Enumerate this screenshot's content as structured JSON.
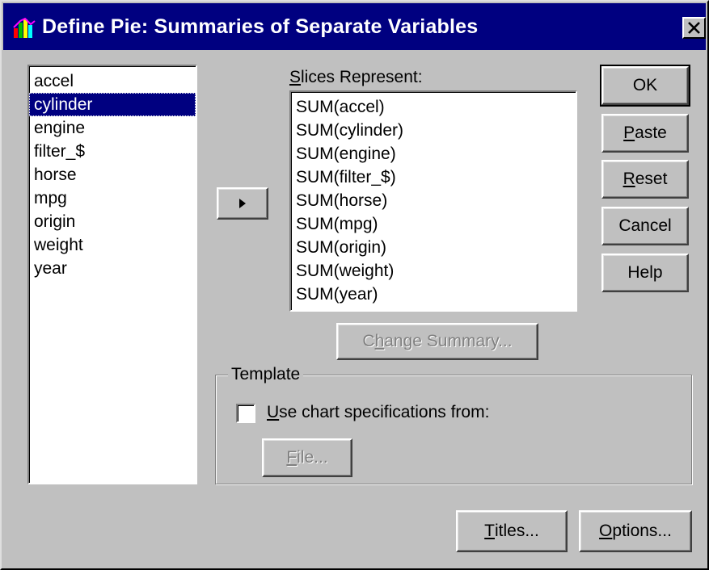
{
  "window": {
    "title": "Define Pie: Summaries of Separate Variables",
    "close_glyph": "✕"
  },
  "variables": [
    "accel",
    "cylinder",
    "engine",
    "filter_$",
    "horse",
    "mpg",
    "origin",
    "weight",
    "year"
  ],
  "selected_variable": "cylinder",
  "slices": {
    "label_accel": "S",
    "label_rest": "lices Represent:",
    "items": [
      "SUM(accel)",
      "SUM(cylinder)",
      "SUM(engine)",
      "SUM(filter_$)",
      "SUM(horse)",
      "SUM(mpg)",
      "SUM(origin)",
      "SUM(weight)",
      "SUM(year)"
    ]
  },
  "buttons": {
    "move_arrow": "▶",
    "ok": "OK",
    "paste_accel": "P",
    "paste_rest": "aste",
    "reset_accel": "R",
    "reset_rest": "eset",
    "cancel": "Cancel",
    "help": "Help",
    "change_pre": "C",
    "change_accel": "h",
    "change_rest": "ange Summary...",
    "file_accel": "F",
    "file_rest": "ile...",
    "titles_accel": "T",
    "titles_rest": "itles...",
    "options_accel": "O",
    "options_rest": "ptions..."
  },
  "template": {
    "title": "Template",
    "checkbox_accel": "U",
    "checkbox_rest": "se chart specifications from:",
    "checked": false
  },
  "icons": {
    "app": "spss-chart-icon",
    "close": "close-icon",
    "arrow": "arrow-right-icon"
  },
  "colors": {
    "title_bar": "#000080",
    "face": "#c0c0c0",
    "selection": "#000080"
  }
}
